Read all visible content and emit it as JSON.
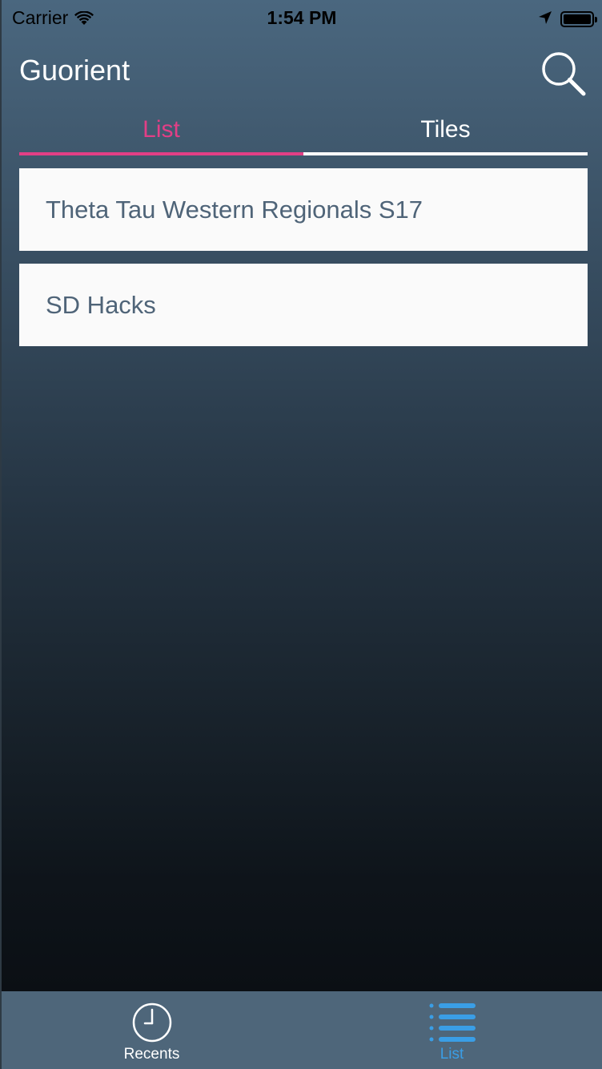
{
  "status_bar": {
    "carrier": "Carrier",
    "time": "1:54 PM",
    "icons": [
      "wifi-icon",
      "location-arrow-icon",
      "battery-icon"
    ]
  },
  "header": {
    "title": "Guorient",
    "search_icon": "search-icon"
  },
  "tabs": [
    {
      "label": "List",
      "active": true
    },
    {
      "label": "Tiles",
      "active": false
    }
  ],
  "events": [
    {
      "title": "Theta Tau Western Regionals S17"
    },
    {
      "title": "SD Hacks"
    }
  ],
  "tab_bar": {
    "items": [
      {
        "label": "Recents",
        "icon": "clock-icon",
        "selected": false
      },
      {
        "label": "List",
        "icon": "list-icon",
        "selected": true
      }
    ]
  },
  "colors": {
    "accent_pink": "#e23f86",
    "tab_selected_blue": "#3a9ee6",
    "list_text": "#4f6478",
    "tab_bar_bg": "#4e667a"
  }
}
